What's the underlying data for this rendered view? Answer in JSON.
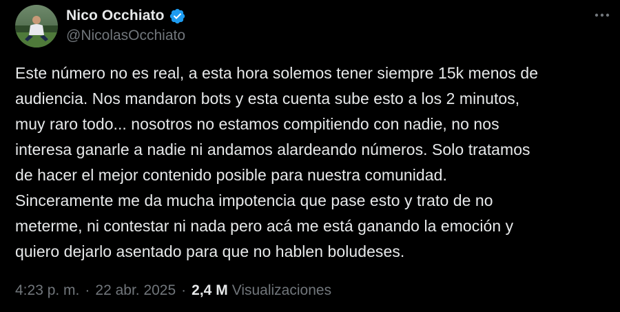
{
  "author": {
    "display_name": "Nico Occhiato",
    "handle": "@NicolasOcchiato",
    "verified": true,
    "avatar_icon": "profile-photo"
  },
  "tweet": {
    "text": "Este número no es real, a esta hora solemos tener siempre 15k menos de\naudiencia. Nos mandaron bots y esta cuenta sube esto a los 2 minutos,\nmuy raro todo... nosotros no estamos compitiendo con nadie, no nos\ninteresa ganarle a nadie ni andamos alardeando números. Solo tratamos\nde hacer el mejor contenido posible para nuestra comunidad.\nSinceramente me da mucha impotencia que pase esto y trato de no\nmeterme, ni contestar ni nada pero acá me está ganando la emoción y\nquiero dejarlo asentado para que no hablen boludeses."
  },
  "meta": {
    "time": "4:23 p. m.",
    "separator": "·",
    "date": "22 abr. 2025",
    "views_count": "2,4 M",
    "views_label": "Visualizaciones"
  },
  "colors": {
    "background": "#000000",
    "text_primary": "#e7e9ea",
    "text_secondary": "#71767b",
    "verified_badge": "#1d9bf0"
  },
  "icons": {
    "more": "more-horizontal-icon",
    "verified": "verified-badge-icon"
  }
}
